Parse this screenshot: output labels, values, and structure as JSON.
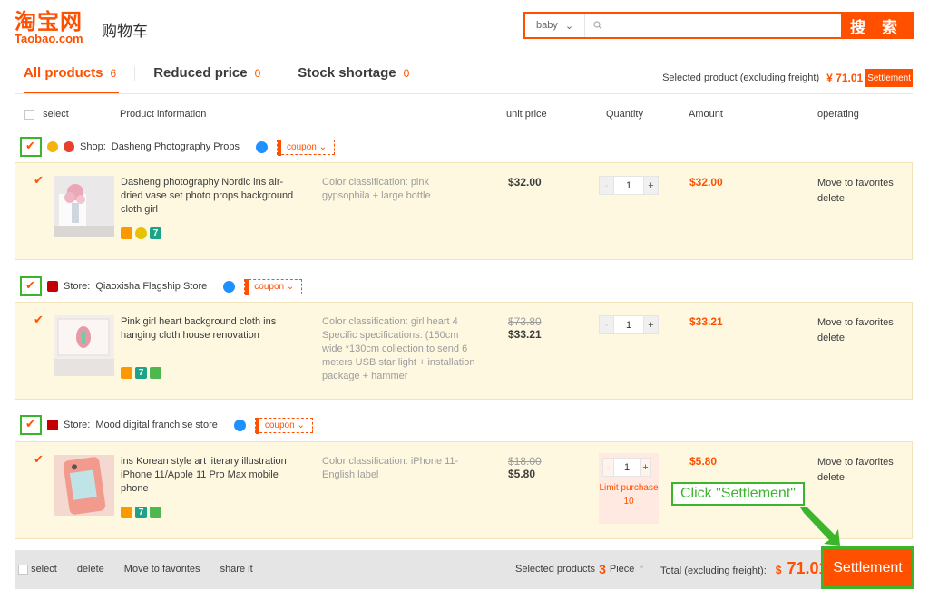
{
  "header": {
    "logo_cn": "淘宝网",
    "logo_en": "Taobao.com",
    "page_title": "购物车",
    "search_category": "baby",
    "search_value": "",
    "search_button": "搜 索"
  },
  "tabs": [
    {
      "label": "All products",
      "count": "6"
    },
    {
      "label": "Reduced price",
      "count": "0"
    },
    {
      "label": "Stock shortage",
      "count": "0"
    }
  ],
  "top_summary": {
    "label": "Selected product (excluding freight)",
    "price": "¥ 71.01",
    "button": "Settlement"
  },
  "columns": {
    "select": "select",
    "info": "Product information",
    "unit": "unit price",
    "qty": "Quantity",
    "amount": "Amount",
    "ops": "operating"
  },
  "shops": [
    {
      "prefix": "Shop:",
      "name": "Dasheng Photography Props",
      "coupon": "coupon",
      "item": {
        "title": "Dasheng photography Nordic ins air-dried vase set photo props background cloth girl",
        "spec": "Color classification: pink gypsophila + large bottle",
        "old_price": "",
        "price": "$32.00",
        "qty": "1",
        "amount": "$32.00"
      }
    },
    {
      "prefix": "Store:",
      "name": "Qiaoxisha Flagship Store",
      "coupon": "coupon",
      "item": {
        "title": "Pink girl heart background cloth ins hanging cloth house renovation",
        "spec": "Color classification: girl heart 4 Specific specifications: (150cm wide *130cm collection to send 6 meters USB star light + installation package + hammer",
        "old_price": "$73.80",
        "price": "$33.21",
        "qty": "1",
        "amount": "$33.21"
      }
    },
    {
      "prefix": "Store:",
      "name": "Mood digital franchise store",
      "coupon": "coupon",
      "item": {
        "title": "ins Korean style art literary illustration iPhone 11/Apple 11 Pro Max mobile phone",
        "spec": "Color classification: iPhone 11-English label",
        "old_price": "$18.00",
        "price": "$5.80",
        "qty": "1",
        "amount": "$5.80",
        "limit_text": "Limit purchase 10"
      }
    }
  ],
  "ops": {
    "favorite": "Move to favorites",
    "delete": "delete"
  },
  "footer": {
    "select": "select",
    "delete": "delete",
    "favorites": "Move to favorites",
    "share": "share it",
    "selected_label": "Selected products",
    "selected_count": "3",
    "selected_unit": "Piece",
    "total_label": "Total (excluding freight):",
    "currency": "$",
    "total": "71.01",
    "settle": "Settlement"
  },
  "callout": "Click \"Settlement\"",
  "colors": {
    "accent": "#ff5000",
    "highlight": "#3cb52c",
    "item_bg": "#fff8e1"
  }
}
